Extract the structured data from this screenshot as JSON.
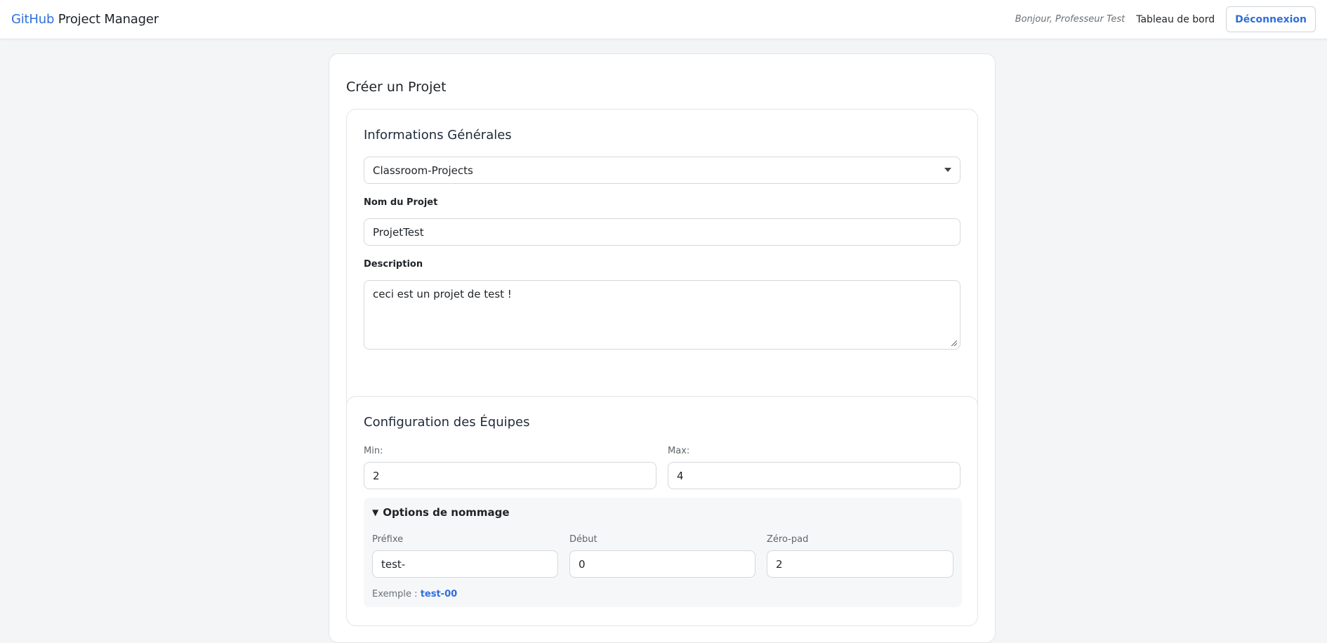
{
  "colors": {
    "accent": "#2f6fdb"
  },
  "header": {
    "brand_accent": "GitHub",
    "brand_rest": " Project Manager",
    "greeting": "Bonjour, Professeur Test",
    "dashboard_link": "Tableau de bord",
    "logout_button": "Déconnexion"
  },
  "page": {
    "title": "Créer un Projet",
    "general": {
      "title": "Informations Générales",
      "organization_select": {
        "value": "Classroom-Projects",
        "icon": "chevron-down-icon"
      },
      "name_label": "Nom du Projet",
      "name_value": "ProjetTest",
      "description_label": "Description",
      "description_value": "ceci est un projet de test !"
    },
    "teams": {
      "title": "Configuration des Équipes",
      "min_label": "Min:",
      "min_value": "2",
      "max_label": "Max:",
      "max_value": "4",
      "naming": {
        "summary_icon": "▼",
        "summary": "Options de nommage",
        "prefix_label": "Préfixe",
        "prefix_value": "test-",
        "start_label": "Début",
        "start_value": "0",
        "zeropad_label": "Zéro-pad",
        "zeropad_value": "2",
        "example_label": "Exemple : ",
        "example_value": "test-00"
      }
    }
  }
}
